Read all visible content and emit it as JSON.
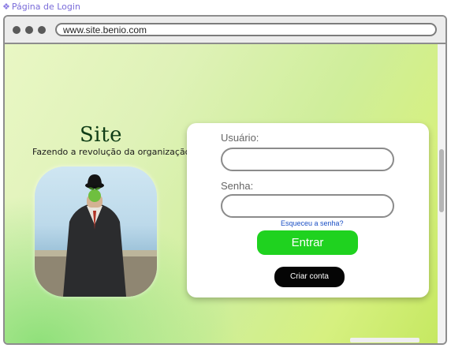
{
  "page_tag": {
    "icon": "diamond-icon",
    "label": "Página de Login"
  },
  "browser": {
    "url": "www.site.benio.com"
  },
  "hero": {
    "title": "Site",
    "tagline": "Fazendo a revolução da organização"
  },
  "login": {
    "username_label": "Usuário:",
    "username_value": "",
    "password_label": "Senha:",
    "password_value": "",
    "forgot_label": "Esqueceu a senha?",
    "enter_label": "Entrar",
    "create_label": "Criar conta"
  },
  "colors": {
    "enter_button": "#1fd21f",
    "create_button": "#050505",
    "title": "#0f3d16",
    "link": "#1a4fc4"
  }
}
